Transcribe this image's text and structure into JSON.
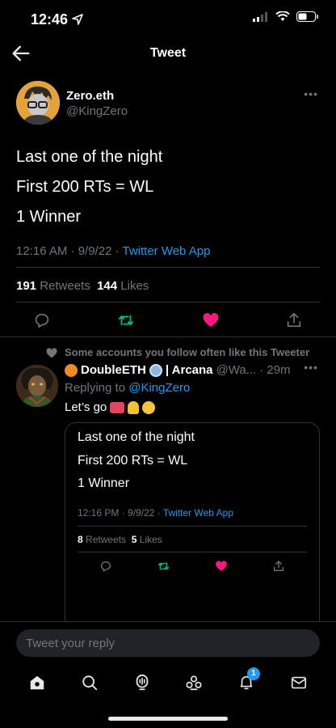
{
  "status_bar": {
    "time": "12:46"
  },
  "header": {
    "title": "Tweet"
  },
  "tweet": {
    "display_name": "Zero.eth",
    "handle": "@KingZero",
    "lines": [
      "Last one of the night",
      "First 200 RTs = WL",
      "1 Winner"
    ],
    "time": "12:16 AM · 9/9/22 · ",
    "source": "Twitter Web App",
    "retweets_count": "191",
    "retweets_label": "Retweets",
    "likes_count": "144",
    "likes_label": "Likes"
  },
  "reply": {
    "social_context": "Some accounts you follow often like this Tweeter",
    "display_name": "DoubleETH",
    "name_suffix": "| Arcana",
    "handle": "@Wa...",
    "age": "· 29m",
    "replying_prefix": "Replying to",
    "replying_handle": "@KingZero",
    "text": "Let’s go",
    "quoted": {
      "lines": [
        "Last one of the night",
        "First 200 RTs = WL",
        "1 Winner"
      ],
      "time": "12:16 PM · 9/9/22 · ",
      "source": "Twitter Web App",
      "retweets_count": "8",
      "retweets_label": "Retweets",
      "likes_count": "5",
      "likes_label": "Likes"
    }
  },
  "compose": {
    "placeholder": "Tweet your reply"
  },
  "tabs": {
    "notifications_badge": "1"
  },
  "colors": {
    "accent": "#1d9bf0",
    "like": "#f91880",
    "retweet": "#00ba7c"
  }
}
